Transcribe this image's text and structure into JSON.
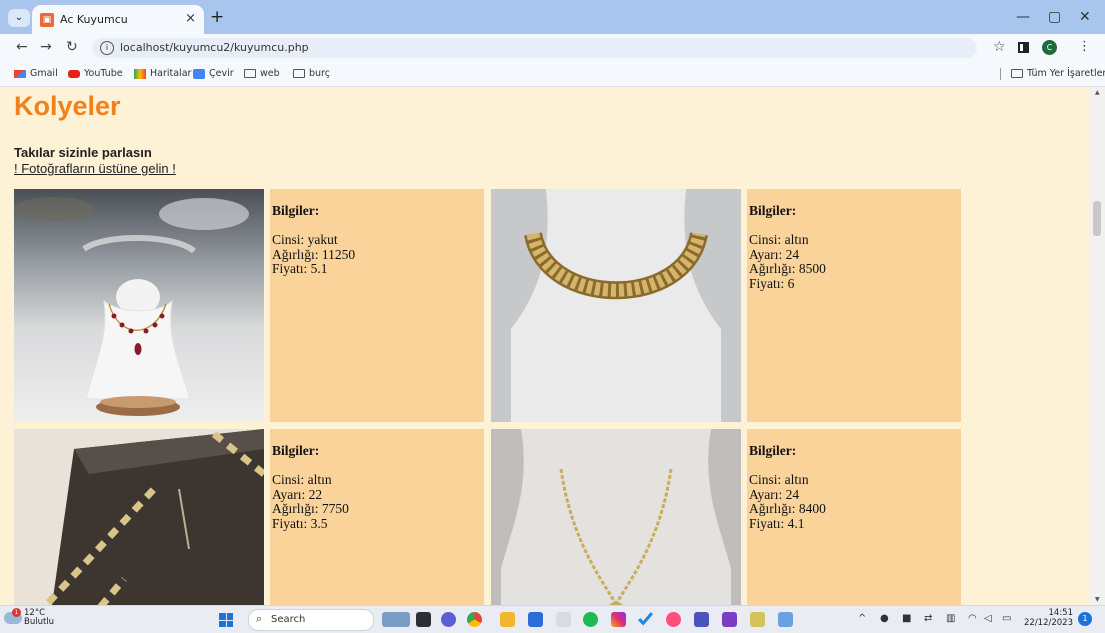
{
  "browser": {
    "tab_title": "Ac Kuyumcu",
    "tab_favicon": "store-icon",
    "url": "localhost/kuyumcu2/kuyumcu.php",
    "bookmarks": [
      "Gmail",
      "YouTube",
      "Haritalar",
      "Çevir",
      "web",
      "burç"
    ],
    "all_bookmarks_label": "Tüm Yer İşaretleri"
  },
  "page": {
    "title": "Kolyeler",
    "slogan": "Takılar sizinle parlasın",
    "hint_link": "! Fotoğrafların üstüne gelin !",
    "info_label": "Bilgiler:"
  },
  "products": [
    {
      "image_alt": "ruby-necklace-on-bust",
      "lines": [
        "Cinsi: yakut",
        "Ağırlığı: 11250",
        "Fiyatı: 5.1"
      ]
    },
    {
      "image_alt": "gold-chain-necklace",
      "lines": [
        "Cinsi: altın",
        "Ayarı: 24",
        "Ağırlığı: 8500",
        "Fiyatı: 6"
      ]
    },
    {
      "image_alt": "gold-bracelet-on-box",
      "lines": [
        "Cinsi: altın",
        "Ayarı: 22",
        "Ağırlığı: 7750",
        "Fiyatı: 3.5"
      ]
    },
    {
      "image_alt": "gold-rope-chain",
      "lines": [
        "Cinsi: altın",
        "Ayarı: 24",
        "Ağırlığı: 8400",
        "Fiyatı: 4.1"
      ]
    }
  ],
  "taskbar": {
    "weather_temp": "12°C",
    "weather_desc": "Bulutlu",
    "weather_badge": "1",
    "search_placeholder": "Search",
    "time": "14:51",
    "date": "22/12/2023",
    "notification_count": "1"
  },
  "colors": {
    "page_bg": "#fdf1d6",
    "title": "#f0821e",
    "info_bg": "#f9d39a"
  }
}
